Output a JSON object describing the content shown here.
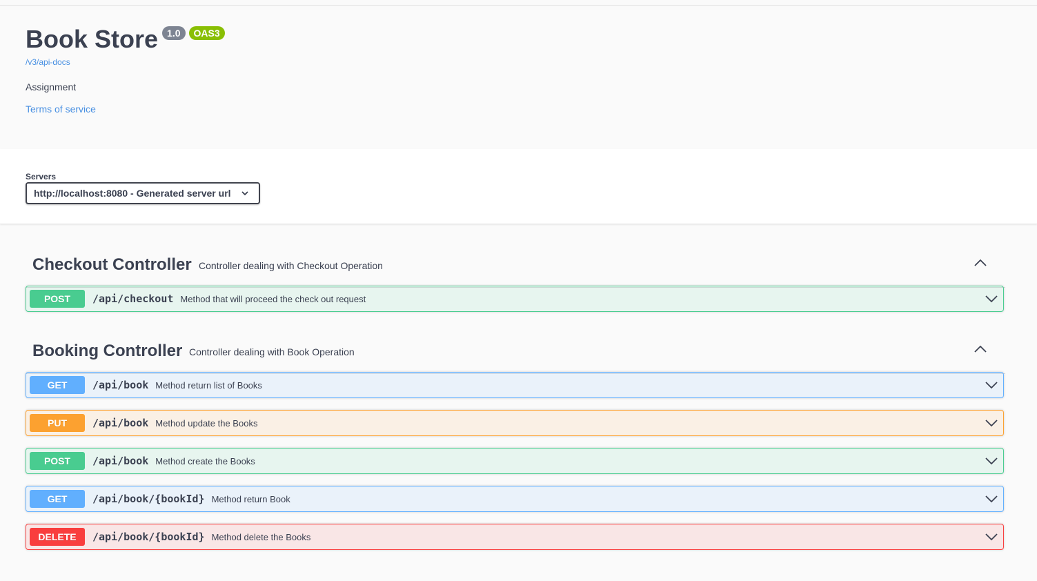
{
  "info": {
    "title": "Book Store",
    "version_badge": "1.0",
    "oas_badge": "OAS3",
    "spec_link": "/v3/api-docs",
    "description": "Assignment",
    "terms_link": "Terms of service"
  },
  "servers": {
    "label": "Servers",
    "selected": "http://localhost:8080 - Generated server url"
  },
  "tags": [
    {
      "name": "Checkout Controller",
      "description": "Controller dealing with Checkout Operation",
      "expanded": true,
      "operations": [
        {
          "method": "POST",
          "path": "/api/checkout",
          "summary": "Method that will proceed the check out request"
        }
      ]
    },
    {
      "name": "Booking Controller",
      "description": "Controller dealing with Book Operation",
      "expanded": true,
      "operations": [
        {
          "method": "GET",
          "path": "/api/book",
          "summary": "Method return list of Books"
        },
        {
          "method": "PUT",
          "path": "/api/book",
          "summary": "Method update the Books"
        },
        {
          "method": "POST",
          "path": "/api/book",
          "summary": "Method create the Books"
        },
        {
          "method": "GET",
          "path": "/api/book/{bookId}",
          "summary": "Method return Book"
        },
        {
          "method": "DELETE",
          "path": "/api/book/{bookId}",
          "summary": "Method delete the Books"
        }
      ]
    }
  ],
  "colors": {
    "post": "#49cc90",
    "get": "#61affe",
    "put": "#fca130",
    "delete": "#f93e3e",
    "link": "#4990e2",
    "version_badge": "#7d8492",
    "oas_badge": "#89bf04"
  },
  "icons": {
    "tag_toggle": "chevron-up-icon",
    "operation_toggle": "chevron-down-icon",
    "server_select": "chevron-down-icon"
  }
}
